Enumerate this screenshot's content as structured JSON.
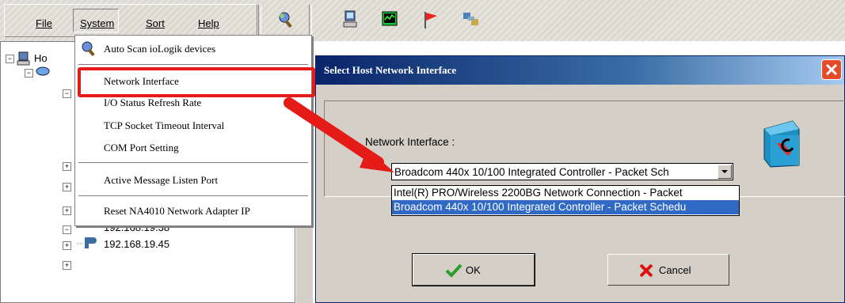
{
  "menubar": {
    "file": "File",
    "system": "System",
    "sort": "Sort",
    "help": "Help"
  },
  "tree": {
    "root_label": "Ho",
    "items": [
      "192.168.19.38",
      "192.168.19.45"
    ]
  },
  "system_menu": {
    "items": [
      "Auto Scan ioLogik devices",
      "Network Interface",
      "I/O Status Refresh Rate",
      "TCP Socket Timeout Interval",
      "COM Port Setting",
      "Active Message Listen Port",
      "Reset NA4010 Network Adapter IP"
    ],
    "highlighted": "Network Interface"
  },
  "dialog": {
    "title": "Select Host Network Interface",
    "field_label": "Network Interface :",
    "selected_value": "Broadcom 440x 10/100 Integrated Controller - Packet Sch",
    "options": [
      "Intel(R) PRO/Wireless 2200BG Network Connection - Packet",
      "Broadcom 440x 10/100 Integrated Controller - Packet Schedu"
    ],
    "ok_label": "OK",
    "cancel_label": "Cancel"
  },
  "colors": {
    "annotation": "#e41b17",
    "title_bar": "#0a246a",
    "selection": "#316ac5"
  }
}
